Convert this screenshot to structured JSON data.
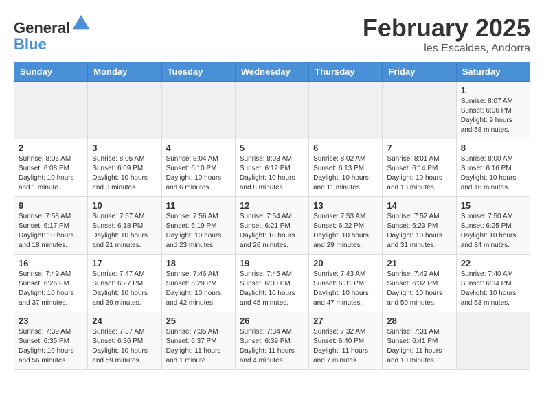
{
  "logo": {
    "general": "General",
    "blue": "Blue"
  },
  "title": "February 2025",
  "location": "les Escaldes, Andorra",
  "weekdays": [
    "Sunday",
    "Monday",
    "Tuesday",
    "Wednesday",
    "Thursday",
    "Friday",
    "Saturday"
  ],
  "weeks": [
    [
      {
        "day": "",
        "info": ""
      },
      {
        "day": "",
        "info": ""
      },
      {
        "day": "",
        "info": ""
      },
      {
        "day": "",
        "info": ""
      },
      {
        "day": "",
        "info": ""
      },
      {
        "day": "",
        "info": ""
      },
      {
        "day": "1",
        "info": "Sunrise: 8:07 AM\nSunset: 6:06 PM\nDaylight: 9 hours and 58 minutes."
      }
    ],
    [
      {
        "day": "2",
        "info": "Sunrise: 8:06 AM\nSunset: 6:08 PM\nDaylight: 10 hours and 1 minute."
      },
      {
        "day": "3",
        "info": "Sunrise: 8:05 AM\nSunset: 6:09 PM\nDaylight: 10 hours and 3 minutes."
      },
      {
        "day": "4",
        "info": "Sunrise: 8:04 AM\nSunset: 6:10 PM\nDaylight: 10 hours and 6 minutes."
      },
      {
        "day": "5",
        "info": "Sunrise: 8:03 AM\nSunset: 6:12 PM\nDaylight: 10 hours and 8 minutes."
      },
      {
        "day": "6",
        "info": "Sunrise: 8:02 AM\nSunset: 6:13 PM\nDaylight: 10 hours and 11 minutes."
      },
      {
        "day": "7",
        "info": "Sunrise: 8:01 AM\nSunset: 6:14 PM\nDaylight: 10 hours and 13 minutes."
      },
      {
        "day": "8",
        "info": "Sunrise: 8:00 AM\nSunset: 6:16 PM\nDaylight: 10 hours and 16 minutes."
      }
    ],
    [
      {
        "day": "9",
        "info": "Sunrise: 7:58 AM\nSunset: 6:17 PM\nDaylight: 10 hours and 18 minutes."
      },
      {
        "day": "10",
        "info": "Sunrise: 7:57 AM\nSunset: 6:18 PM\nDaylight: 10 hours and 21 minutes."
      },
      {
        "day": "11",
        "info": "Sunrise: 7:56 AM\nSunset: 6:19 PM\nDaylight: 10 hours and 23 minutes."
      },
      {
        "day": "12",
        "info": "Sunrise: 7:54 AM\nSunset: 6:21 PM\nDaylight: 10 hours and 26 minutes."
      },
      {
        "day": "13",
        "info": "Sunrise: 7:53 AM\nSunset: 6:22 PM\nDaylight: 10 hours and 29 minutes."
      },
      {
        "day": "14",
        "info": "Sunrise: 7:52 AM\nSunset: 6:23 PM\nDaylight: 10 hours and 31 minutes."
      },
      {
        "day": "15",
        "info": "Sunrise: 7:50 AM\nSunset: 6:25 PM\nDaylight: 10 hours and 34 minutes."
      }
    ],
    [
      {
        "day": "16",
        "info": "Sunrise: 7:49 AM\nSunset: 6:26 PM\nDaylight: 10 hours and 37 minutes."
      },
      {
        "day": "17",
        "info": "Sunrise: 7:47 AM\nSunset: 6:27 PM\nDaylight: 10 hours and 39 minutes."
      },
      {
        "day": "18",
        "info": "Sunrise: 7:46 AM\nSunset: 6:29 PM\nDaylight: 10 hours and 42 minutes."
      },
      {
        "day": "19",
        "info": "Sunrise: 7:45 AM\nSunset: 6:30 PM\nDaylight: 10 hours and 45 minutes."
      },
      {
        "day": "20",
        "info": "Sunrise: 7:43 AM\nSunset: 6:31 PM\nDaylight: 10 hours and 47 minutes."
      },
      {
        "day": "21",
        "info": "Sunrise: 7:42 AM\nSunset: 6:32 PM\nDaylight: 10 hours and 50 minutes."
      },
      {
        "day": "22",
        "info": "Sunrise: 7:40 AM\nSunset: 6:34 PM\nDaylight: 10 hours and 53 minutes."
      }
    ],
    [
      {
        "day": "23",
        "info": "Sunrise: 7:39 AM\nSunset: 6:35 PM\nDaylight: 10 hours and 56 minutes."
      },
      {
        "day": "24",
        "info": "Sunrise: 7:37 AM\nSunset: 6:36 PM\nDaylight: 10 hours and 59 minutes."
      },
      {
        "day": "25",
        "info": "Sunrise: 7:35 AM\nSunset: 6:37 PM\nDaylight: 11 hours and 1 minute."
      },
      {
        "day": "26",
        "info": "Sunrise: 7:34 AM\nSunset: 6:39 PM\nDaylight: 11 hours and 4 minutes."
      },
      {
        "day": "27",
        "info": "Sunrise: 7:32 AM\nSunset: 6:40 PM\nDaylight: 11 hours and 7 minutes."
      },
      {
        "day": "28",
        "info": "Sunrise: 7:31 AM\nSunset: 6:41 PM\nDaylight: 11 hours and 10 minutes."
      },
      {
        "day": "",
        "info": ""
      }
    ]
  ]
}
